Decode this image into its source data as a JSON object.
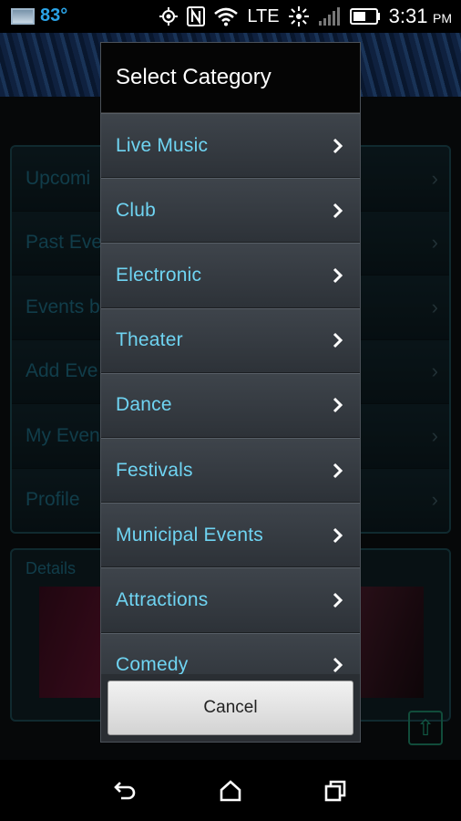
{
  "status_bar": {
    "temperature": "83°",
    "network": "LTE",
    "time": "3:31",
    "ampm": "PM"
  },
  "background": {
    "menu_items": [
      "Upcomi",
      "Past Eve",
      "Events b",
      "Add Eve",
      "My Even",
      "Profile"
    ],
    "details_label": "Details"
  },
  "dialog": {
    "title": "Select Category",
    "categories": [
      "Live Music",
      "Club",
      "Electronic",
      "Theater",
      "Dance",
      "Festivals",
      "Municipal Events",
      "Attractions",
      "Comedy"
    ],
    "cancel_label": "Cancel"
  },
  "colors": {
    "category_text": "#6fd4f2",
    "temperature": "#2aa3e6"
  }
}
